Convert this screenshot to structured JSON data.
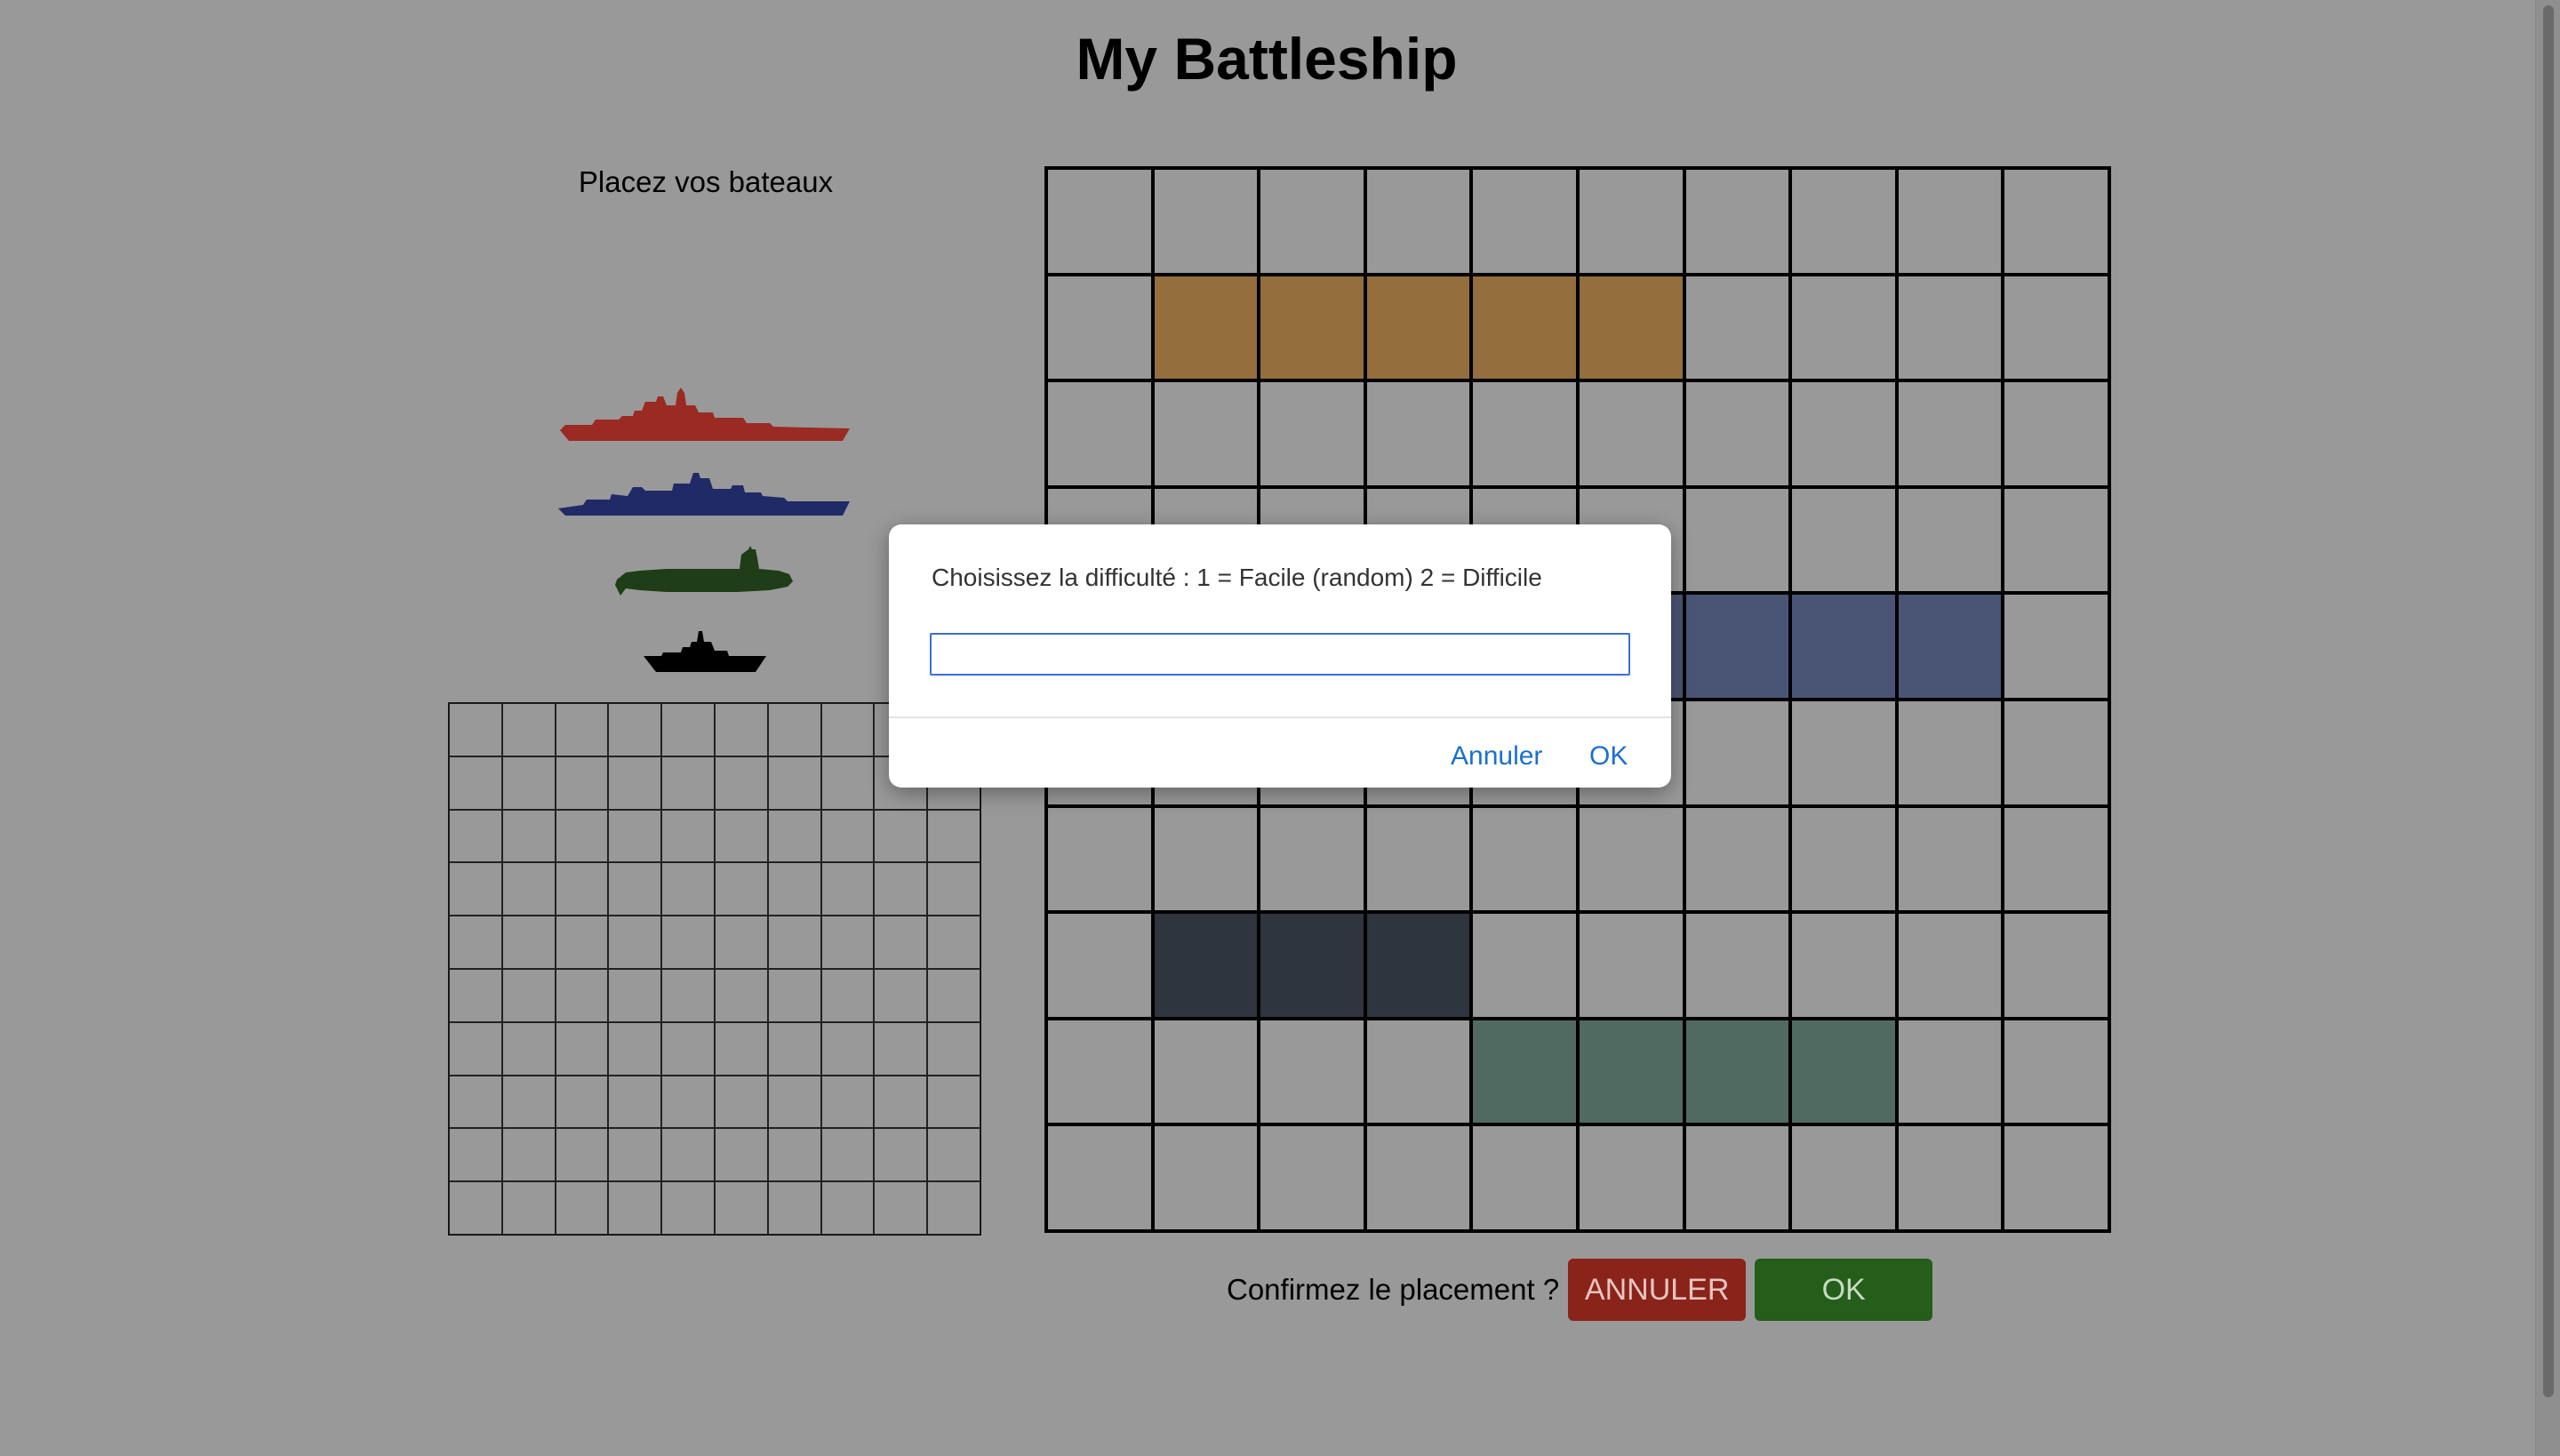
{
  "page": {
    "title": "My Battleship",
    "place_label": "Placez vos bateaux"
  },
  "ships": [
    {
      "name": "battleship",
      "color": "#9b2a22",
      "icon": "battleship-icon"
    },
    {
      "name": "cruiser",
      "color": "#1f2a66",
      "icon": "cruiser-icon"
    },
    {
      "name": "submarine",
      "color": "#1f3d17",
      "icon": "submarine-icon"
    },
    {
      "name": "patrol-boat",
      "color": "#000000",
      "icon": "patrol-boat-icon"
    }
  ],
  "board": {
    "rows": 10,
    "cols": 10,
    "placed_ships": [
      {
        "color": "#946e3c",
        "row": 1,
        "col": 1,
        "length": 5,
        "orientation": "horizontal"
      },
      {
        "color": "#4a5575",
        "row": 4,
        "col": 5,
        "length": 4,
        "orientation": "horizontal"
      },
      {
        "color": "#2f353e",
        "row": 7,
        "col": 1,
        "length": 3,
        "orientation": "horizontal"
      },
      {
        "color": "#506a62",
        "row": 8,
        "col": 4,
        "length": 4,
        "orientation": "horizontal"
      }
    ]
  },
  "confirm": {
    "label": "Confirmez le placement ?",
    "cancel_label": "ANNULER",
    "ok_label": "OK"
  },
  "dialog": {
    "message": "Choisissez la difficulté : 1 = Facile (random) 2 = Difficile",
    "input_value": "",
    "cancel_label": "Annuler",
    "ok_label": "OK"
  }
}
